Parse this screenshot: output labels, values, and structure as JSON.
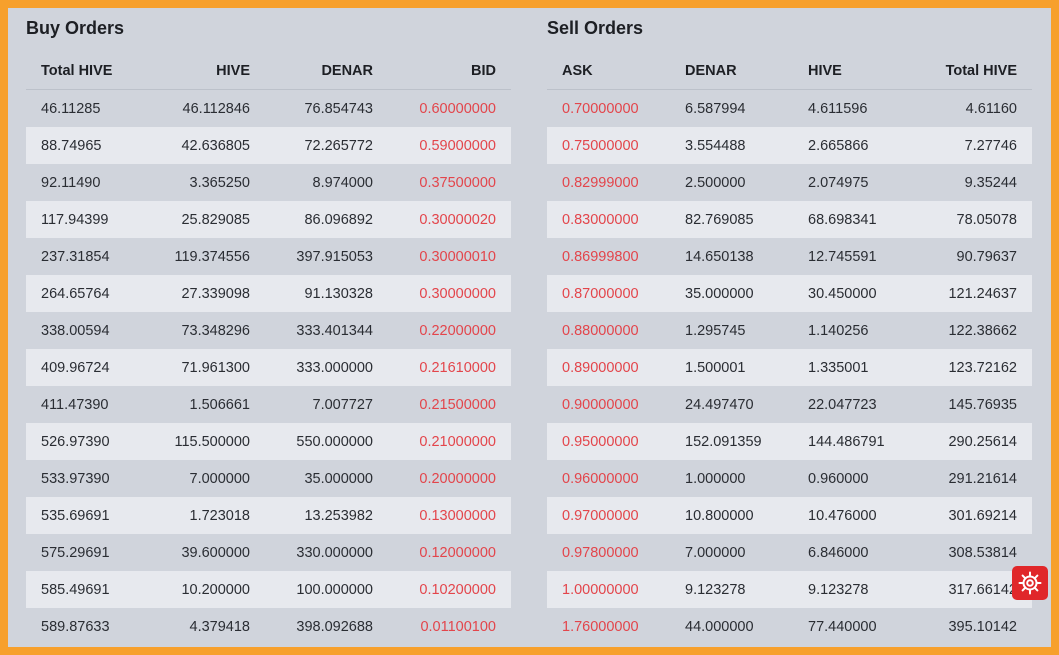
{
  "buy": {
    "title": "Buy Orders",
    "headers": [
      "Total HIVE",
      "HIVE",
      "DENAR",
      "BID"
    ],
    "rows": [
      [
        "46.11285",
        "46.112846",
        "76.854743",
        "0.60000000"
      ],
      [
        "88.74965",
        "42.636805",
        "72.265772",
        "0.59000000"
      ],
      [
        "92.11490",
        "3.365250",
        "8.974000",
        "0.37500000"
      ],
      [
        "117.94399",
        "25.829085",
        "86.096892",
        "0.30000020"
      ],
      [
        "237.31854",
        "119.374556",
        "397.915053",
        "0.30000010"
      ],
      [
        "264.65764",
        "27.339098",
        "91.130328",
        "0.30000000"
      ],
      [
        "338.00594",
        "73.348296",
        "333.401344",
        "0.22000000"
      ],
      [
        "409.96724",
        "71.961300",
        "333.000000",
        "0.21610000"
      ],
      [
        "411.47390",
        "1.506661",
        "7.007727",
        "0.21500000"
      ],
      [
        "526.97390",
        "115.500000",
        "550.000000",
        "0.21000000"
      ],
      [
        "533.97390",
        "7.000000",
        "35.000000",
        "0.20000000"
      ],
      [
        "535.69691",
        "1.723018",
        "13.253982",
        "0.13000000"
      ],
      [
        "575.29691",
        "39.600000",
        "330.000000",
        "0.12000000"
      ],
      [
        "585.49691",
        "10.200000",
        "100.000000",
        "0.10200000"
      ],
      [
        "589.87633",
        "4.379418",
        "398.092688",
        "0.01100100"
      ]
    ]
  },
  "sell": {
    "title": "Sell Orders",
    "headers": [
      "ASK",
      "DENAR",
      "HIVE",
      "Total HIVE"
    ],
    "rows": [
      [
        "0.70000000",
        "6.587994",
        "4.611596",
        "4.61160"
      ],
      [
        "0.75000000",
        "3.554488",
        "2.665866",
        "7.27746"
      ],
      [
        "0.82999000",
        "2.500000",
        "2.074975",
        "9.35244"
      ],
      [
        "0.83000000",
        "82.769085",
        "68.698341",
        "78.05078"
      ],
      [
        "0.86999800",
        "14.650138",
        "12.745591",
        "90.79637"
      ],
      [
        "0.87000000",
        "35.000000",
        "30.450000",
        "121.24637"
      ],
      [
        "0.88000000",
        "1.295745",
        "1.140256",
        "122.38662"
      ],
      [
        "0.89000000",
        "1.500001",
        "1.335001",
        "123.72162"
      ],
      [
        "0.90000000",
        "24.497470",
        "22.047723",
        "145.76935"
      ],
      [
        "0.95000000",
        "152.091359",
        "144.486791",
        "290.25614"
      ],
      [
        "0.96000000",
        "1.000000",
        "0.960000",
        "291.21614"
      ],
      [
        "0.97000000",
        "10.800000",
        "10.476000",
        "301.69214"
      ],
      [
        "0.97800000",
        "7.000000",
        "6.846000",
        "308.53814"
      ],
      [
        "1.00000000",
        "9.123278",
        "9.123278",
        "317.66142"
      ],
      [
        "1.76000000",
        "44.000000",
        "77.440000",
        "395.10142"
      ]
    ]
  },
  "colors": {
    "frame": "#f7a02c",
    "background": "#d0d4dc",
    "price": "#e3454b",
    "settings_button": "#e0272a"
  },
  "settings_button_icon": "gear-icon"
}
